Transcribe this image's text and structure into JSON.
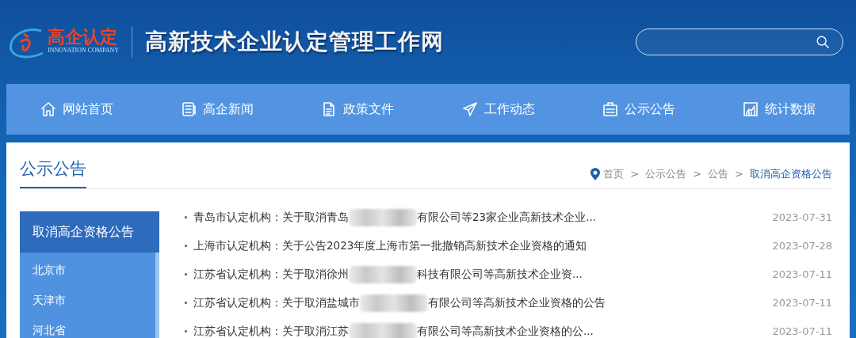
{
  "header": {
    "logo_text": "高企认定",
    "logo_subtext": "INNOVATION COMPANY",
    "site_title": "高新技术企业认定管理工作网"
  },
  "nav": [
    {
      "label": "网站首页",
      "selected": false
    },
    {
      "label": "高企新闻",
      "selected": false
    },
    {
      "label": "政策文件",
      "selected": false
    },
    {
      "label": "工作动态",
      "selected": false
    },
    {
      "label": "公示公告",
      "selected": false
    },
    {
      "label": "统计数据",
      "selected": false
    }
  ],
  "section_title": "公示公告",
  "breadcrumb": [
    {
      "label": "首页",
      "selected": false
    },
    {
      "label": "公示公告",
      "selected": false
    },
    {
      "label": "公告",
      "selected": false
    },
    {
      "label": "取消高企资格公告",
      "selected": true
    }
  ],
  "breadcrumb_separator": ">",
  "sidebar": {
    "title": "取消高企资格公告",
    "items": [
      {
        "label": "北京市"
      },
      {
        "label": "天津市"
      },
      {
        "label": "河北省"
      }
    ]
  },
  "notices": [
    {
      "title_start": "青岛市认定机构：关于取消青岛",
      "redacted": true,
      "title_end": "有限公司等23家企业高新技术企业...",
      "date": "2023-07-31"
    },
    {
      "title_start": "上海市认定机构：关于公告2023年度上海市第一批撤销高新技术企业资格的通知",
      "redacted": false,
      "date": "2023-07-28"
    },
    {
      "title_start": "江苏省认定机构：关于取消徐州",
      "redacted": true,
      "title_end": "科技有限公司等高新技术企业资...",
      "date": "2023-07-11"
    },
    {
      "title_start": "江苏省认定机构：关于取消盐城市",
      "redacted": true,
      "title_end": "有限公司等高新技术企业资格的公告",
      "date": "2023-07-11"
    },
    {
      "title_start": "江苏省认定机构：关于取消江苏",
      "redacted": true,
      "title_end": "有限公司等高新技术企业资格的公...",
      "date": "2023-07-11"
    }
  ]
}
